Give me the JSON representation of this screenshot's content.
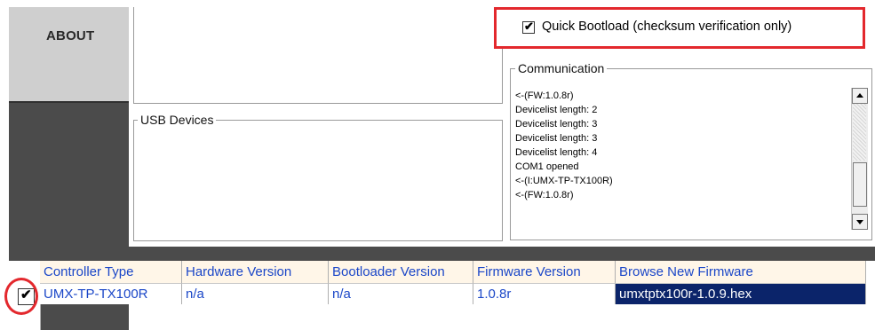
{
  "sidebar": {
    "active_item": "ABOUT"
  },
  "quick_bootload": {
    "label": "Quick Bootload (checksum verification only)",
    "checked": true,
    "highlight_color": "#e3282d"
  },
  "usb_devices": {
    "legend": "USB Devices"
  },
  "communication": {
    "legend": "Communication",
    "log": [
      "<-(FW:1.0.8r)",
      "Devicelist length: 2",
      "Devicelist length: 3",
      "Devicelist length: 3",
      "Devicelist length: 4",
      "COM1 opened",
      "<-(I:UMX-TP-TX100R)",
      "<-(FW:1.0.8r)"
    ]
  },
  "table": {
    "headers": [
      "Controller Type",
      "Hardware Version",
      "Bootloader Version",
      "Firmware Version",
      "Browse New Firmware"
    ],
    "rows": [
      {
        "checked": true,
        "controller_type": "UMX-TP-TX100R",
        "hardware_version": "n/a",
        "bootloader_version": "n/a",
        "firmware_version": "1.0.8r",
        "browse_new_firmware": "umxtptx100r-1.0.9.hex"
      }
    ],
    "header_text_color": "#1b47c8",
    "selected_cell_color": "#0b246a"
  }
}
